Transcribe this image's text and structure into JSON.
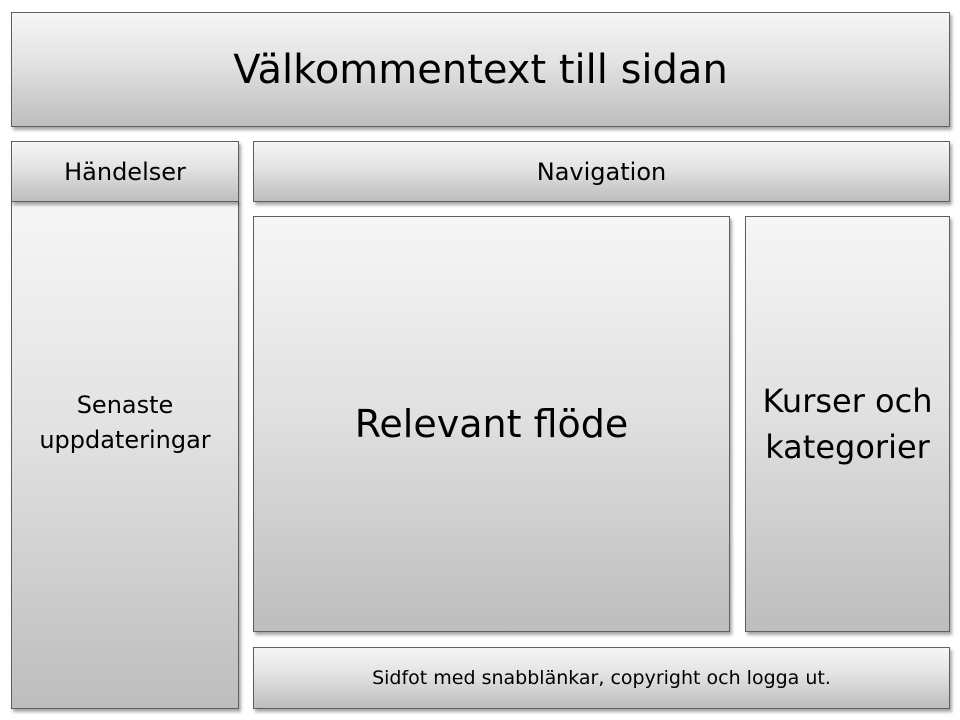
{
  "header": {
    "text": "Välkommentext till sidan"
  },
  "events": {
    "title": "Händelser",
    "body": "Senaste\nuppdateringar"
  },
  "navigation": {
    "text": "Navigation"
  },
  "feed": {
    "text": "Relevant flöde"
  },
  "courses": {
    "text": "Kurser och\nkategorier"
  },
  "footer": {
    "text": "Sidfot med snabblänkar, copyright och logga ut."
  },
  "colors": {
    "box_light": "#f6f6f6",
    "box_mid": "#e2e2e2",
    "box_dark": "#bdbdbd",
    "border": "#5f5f5f",
    "text": "#000000"
  }
}
